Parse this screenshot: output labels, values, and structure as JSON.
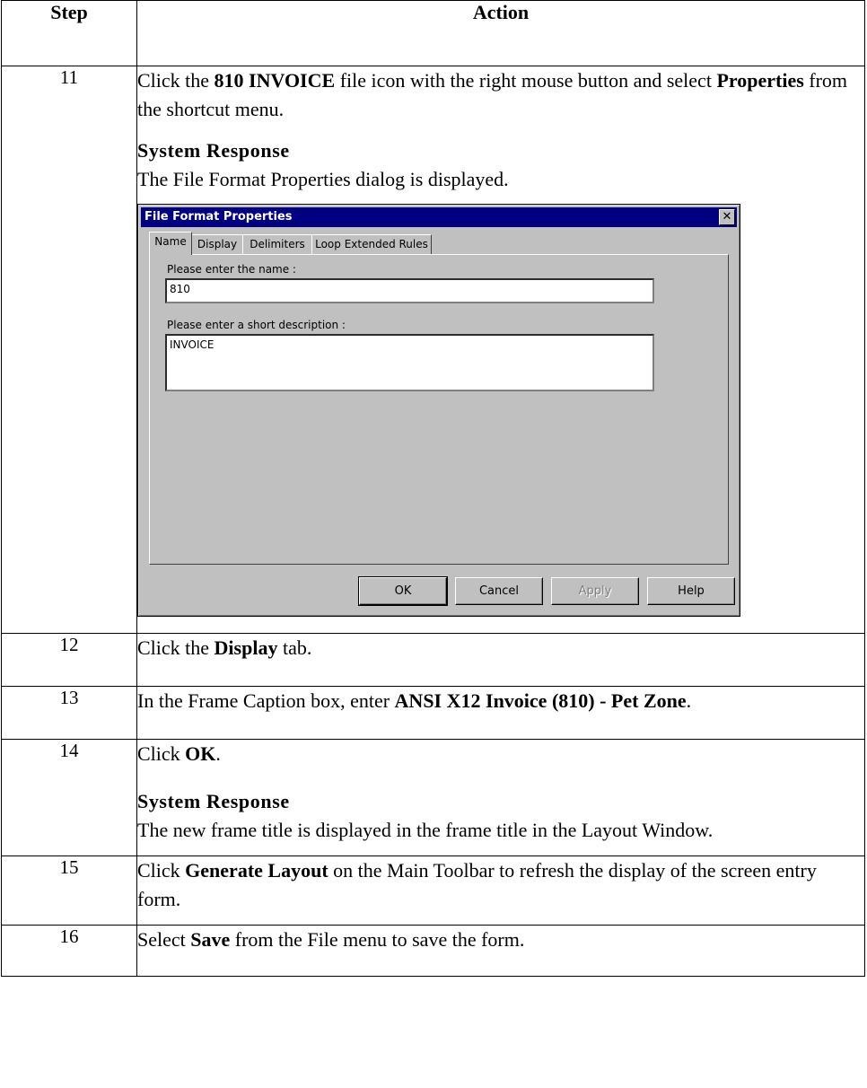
{
  "table": {
    "header": {
      "step": "Step",
      "action": "Action"
    }
  },
  "steps": {
    "s11": {
      "num": "11",
      "pre": "Click the ",
      "bold1": "810 INVOICE",
      "mid": " file icon with the right mouse button and select ",
      "bold2": "Properties",
      "post": " from the shortcut menu.",
      "response_heading": "System Response",
      "response_text": "The File Format Properties dialog is displayed."
    },
    "s12": {
      "num": "12",
      "pre": "Click the ",
      "bold": "Display",
      "post": " tab."
    },
    "s13": {
      "num": "13",
      "pre": "In the Frame Caption box, enter ",
      "bold": "ANSI X12 Invoice (810) - Pet Zone",
      "post": "."
    },
    "s14": {
      "num": "14",
      "pre": "Click ",
      "bold": "OK",
      "post": ".",
      "response_heading": "System Response",
      "response_text": "The new frame title is displayed in the frame title in the Layout Window."
    },
    "s15": {
      "num": "15",
      "pre": "Click ",
      "bold": "Generate Layout",
      "post": " on the Main Toolbar to refresh the display of the screen entry form."
    },
    "s16": {
      "num": "16",
      "pre": "Select ",
      "bold": "Save",
      "post": " from the File menu to save the form."
    }
  },
  "dialog": {
    "title": "File Format Properties",
    "close_glyph": "✕",
    "tabs": [
      "Name",
      "Display",
      "Delimiters",
      "Loop Extended Rules"
    ],
    "name_label": "Please enter the name :",
    "name_value": "810",
    "desc_label": "Please enter a short description :",
    "desc_value": "INVOICE",
    "buttons": {
      "ok": "OK",
      "cancel": "Cancel",
      "apply": "Apply",
      "help": "Help"
    }
  }
}
